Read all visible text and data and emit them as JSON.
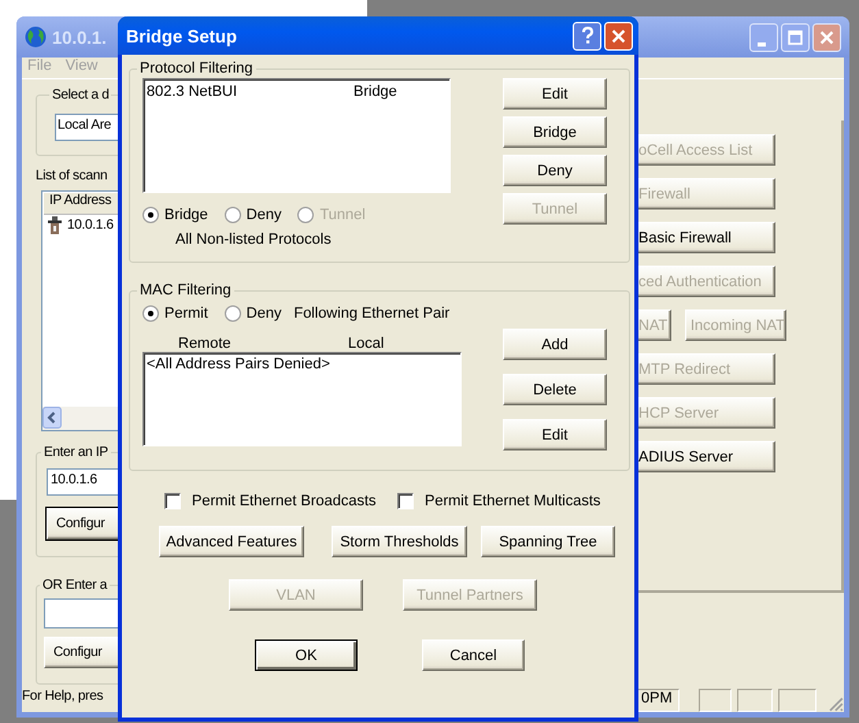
{
  "main_window": {
    "title": "10.0.1.",
    "menu": [
      "File",
      "View"
    ],
    "device_group": {
      "label": "Select a d",
      "value": "Local Are"
    },
    "list_label": "List of scann",
    "list": {
      "columns": [
        "IP Address"
      ],
      "rows": [
        "10.0.1.6"
      ]
    },
    "ip_group": {
      "label": "Enter an IP",
      "value": "10.0.1.6",
      "button": "Configur"
    },
    "or_group": {
      "label": "OR Enter a",
      "button": "Configur"
    },
    "feature_rows": [
      [
        {
          "label": "oCell Access List",
          "disabled": true
        }
      ],
      [
        {
          "label": "Firewall",
          "disabled": true
        }
      ],
      [
        {
          "label": "Basic Firewall",
          "disabled": false
        }
      ],
      [
        {
          "label": "ced Authentication",
          "disabled": true
        }
      ],
      [
        {
          "label": "NAT",
          "disabled": true
        },
        {
          "label": "Incoming NAT",
          "disabled": true
        }
      ],
      [
        {
          "label": "MTP Redirect",
          "disabled": true
        }
      ],
      [
        {
          "label": "HCP Server",
          "disabled": true
        }
      ],
      [
        {
          "label": "ADIUS Server",
          "disabled": false
        }
      ]
    ],
    "status_bar": [
      "For Help, pres",
      "0PM"
    ]
  },
  "dialog": {
    "title": "Bridge Setup",
    "protocol_filtering": {
      "label": "Protocol Filtering",
      "rows": [
        {
          "protocol": "802.3 NetBUI",
          "action": "Bridge"
        }
      ],
      "buttons": [
        {
          "label": "Edit",
          "disabled": false
        },
        {
          "label": "Bridge",
          "disabled": false
        },
        {
          "label": "Deny",
          "disabled": false
        },
        {
          "label": "Tunnel",
          "disabled": true
        }
      ],
      "radios": [
        {
          "label": "Bridge",
          "selected": true,
          "disabled": false
        },
        {
          "label": "Deny",
          "selected": false,
          "disabled": false
        },
        {
          "label": "Tunnel",
          "selected": false,
          "disabled": true
        }
      ],
      "caption": "All Non-listed Protocols"
    },
    "mac_filtering": {
      "label": "MAC Filtering",
      "radios": [
        {
          "label": "Permit",
          "selected": true,
          "disabled": false
        },
        {
          "label": "Deny",
          "selected": false,
          "disabled": false
        }
      ],
      "caption": "Following Ethernet Pair",
      "columns": [
        "Remote",
        "Local"
      ],
      "rows": [
        "<All Address Pairs Denied>"
      ],
      "buttons": [
        {
          "label": "Add",
          "disabled": false
        },
        {
          "label": "Delete",
          "disabled": false
        },
        {
          "label": "Edit",
          "disabled": false
        }
      ]
    },
    "checkboxes": [
      {
        "label": "Permit Ethernet Broadcasts",
        "checked": false
      },
      {
        "label": "Permit Ethernet Multicasts",
        "checked": false
      }
    ],
    "action_rows": [
      [
        {
          "label": "Advanced Features",
          "disabled": false
        },
        {
          "label": "Storm Thresholds",
          "disabled": false
        },
        {
          "label": "Spanning Tree",
          "disabled": false
        }
      ],
      [
        {
          "label": "VLAN",
          "disabled": true
        },
        {
          "label": "Tunnel Partners",
          "disabled": true
        }
      ]
    ],
    "footer_buttons": [
      {
        "label": "OK",
        "default": true
      },
      {
        "label": "Cancel",
        "default": false
      }
    ]
  }
}
